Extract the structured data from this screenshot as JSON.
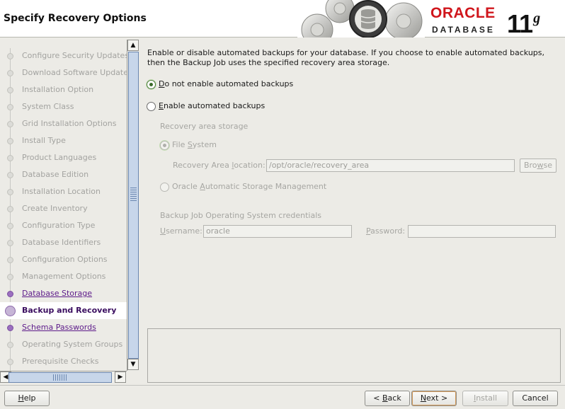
{
  "header": {
    "title": "Specify Recovery Options",
    "brand": "ORACLE",
    "product": "DATABASE",
    "version": "11",
    "version_suffix": "g"
  },
  "nav": {
    "steps": [
      {
        "label": "Configure Security Updates",
        "state": "pending"
      },
      {
        "label": "Download Software Updates",
        "state": "pending"
      },
      {
        "label": "Installation Option",
        "state": "pending"
      },
      {
        "label": "System Class",
        "state": "pending"
      },
      {
        "label": "Grid Installation Options",
        "state": "pending"
      },
      {
        "label": "Install Type",
        "state": "pending"
      },
      {
        "label": "Product Languages",
        "state": "pending"
      },
      {
        "label": "Database Edition",
        "state": "pending"
      },
      {
        "label": "Installation Location",
        "state": "pending"
      },
      {
        "label": "Create Inventory",
        "state": "pending"
      },
      {
        "label": "Configuration Type",
        "state": "pending"
      },
      {
        "label": "Database Identifiers",
        "state": "pending"
      },
      {
        "label": "Configuration Options",
        "state": "pending"
      },
      {
        "label": "Management Options",
        "state": "pending"
      },
      {
        "label": "Database Storage",
        "state": "done"
      },
      {
        "label": "Backup and Recovery",
        "state": "current"
      },
      {
        "label": "Schema Passwords",
        "state": "done"
      },
      {
        "label": "Operating System Groups",
        "state": "pending"
      },
      {
        "label": "Prerequisite Checks",
        "state": "pending"
      }
    ]
  },
  "content": {
    "intro": "Enable or disable automated backups for your database. If you choose to enable automated backups, then the Backup Job uses the specified recovery area storage.",
    "options": {
      "no_backup": {
        "mnemonic": "D",
        "rest": "o not enable automated backups",
        "selected": true
      },
      "enable_backup": {
        "mnemonic": "E",
        "rest": "nable automated backups",
        "selected": false
      }
    },
    "recovery_storage_label": "Recovery area storage",
    "file_system": {
      "pre": "File ",
      "mnemonic": "S",
      "post": "ystem",
      "selected": true
    },
    "recovery_location": {
      "pre": "Recovery Area ",
      "mnemonic": "l",
      "post": "ocation:",
      "value": "/opt/oracle/recovery_area"
    },
    "browse_button": {
      "mnemonic": "w",
      "pre": "Bro",
      "post": "se"
    },
    "asm": {
      "pre": "Oracle ",
      "mnemonic": "A",
      "post": "utomatic Storage Management",
      "selected": false
    },
    "credentials_label": "Backup Job Operating System credentials",
    "username": {
      "pre": "",
      "mnemonic": "U",
      "post": "sername:",
      "value": "oracle"
    },
    "password": {
      "pre": "",
      "mnemonic": "P",
      "post": "assword:",
      "value": ""
    }
  },
  "footer": {
    "help": {
      "mnemonic": "H",
      "post": "elp"
    },
    "back": {
      "pre": "< ",
      "mnemonic": "B",
      "post": "ack"
    },
    "next": {
      "pre": "",
      "mnemonic": "N",
      "post": "ext >"
    },
    "install": {
      "pre": "",
      "mnemonic": "I",
      "post": "nstall"
    },
    "cancel": {
      "label": "Cancel"
    }
  },
  "colors": {
    "current_step_text": "#3a0d5f",
    "done_step_text": "#5d1b8a",
    "brand_red": "#d0161c"
  }
}
